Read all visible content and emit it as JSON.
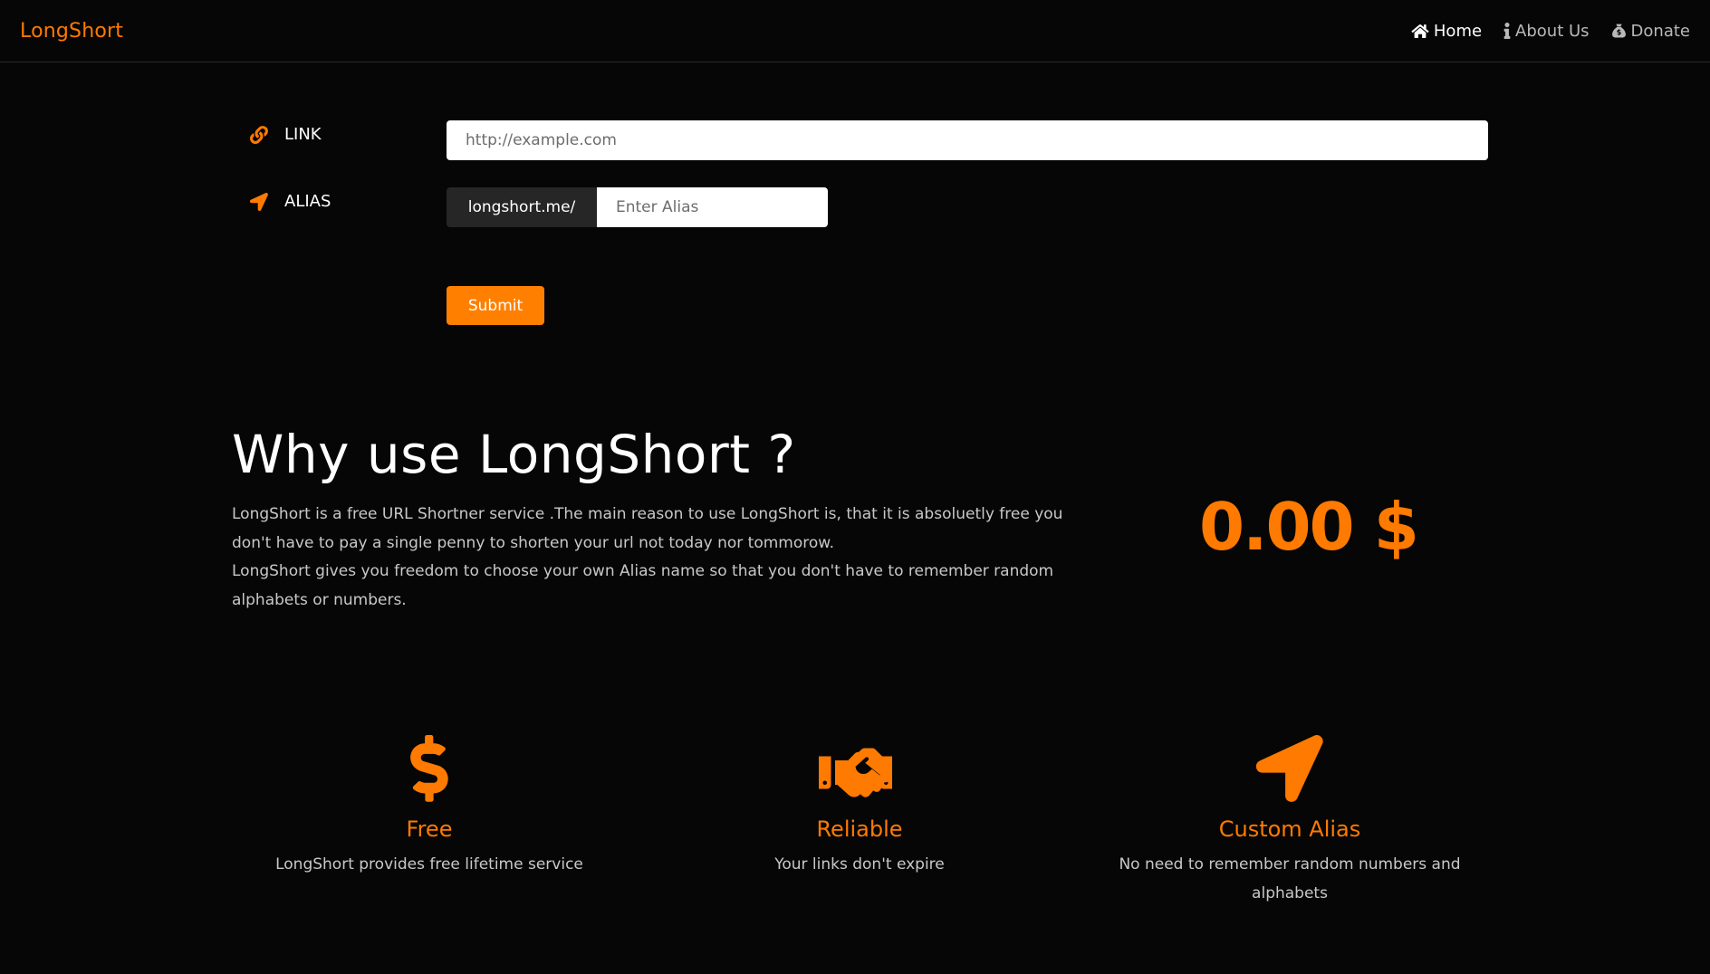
{
  "brand": "LongShort",
  "nav": {
    "home": "Home",
    "about": "About Us",
    "donate": "Donate"
  },
  "form": {
    "link_label": "LINK",
    "link_placeholder": "http://example.com",
    "alias_label": "ALIAS",
    "alias_prefix": "longshort.me/",
    "alias_placeholder": "Enter Alias",
    "submit_label": "Submit"
  },
  "why": {
    "title": "Why use LongShort ?",
    "paragraph_1": "LongShort is a free URL Shortner service .The main reason to use LongShort is, that it is absoluetly free you don't have to pay a single penny to shorten your url not today nor tommorow.",
    "paragraph_2": "LongShort gives you freedom to choose your own Alias name so that you don't have to remember random alphabets or numbers.",
    "price": "0.00 $"
  },
  "features": [
    {
      "icon": "dollar-icon",
      "title": "Free",
      "description": "LongShort provides free lifetime service"
    },
    {
      "icon": "handshake-icon",
      "title": "Reliable",
      "description": "Your links don't expire"
    },
    {
      "icon": "location-arrow-icon",
      "title": "Custom Alias",
      "description": "No need to remember random numbers and alphabets"
    }
  ],
  "colors": {
    "accent": "#ff7a00",
    "background": "#060606",
    "prefix_bg": "#262626"
  }
}
